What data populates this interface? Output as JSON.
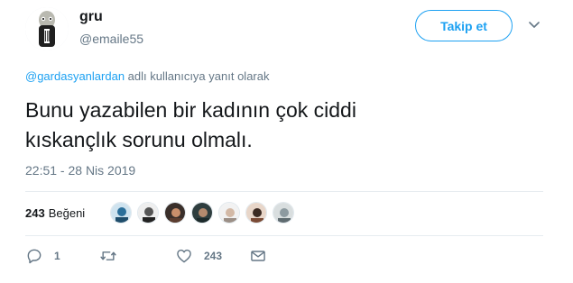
{
  "author": {
    "name": "gru",
    "handle": "@emaile55"
  },
  "follow_label": "Takip et",
  "reply_context": {
    "mention": "@gardasyanlardan",
    "suffix": "adlı kullanıcıya yanıt olarak"
  },
  "tweet": {
    "lines": [
      "Bunu yazabilen bir kadının çok ciddi",
      "kıskançlık sorunu olmalı."
    ],
    "timestamp": "22:51 - 28 Nis 2019"
  },
  "likes": {
    "count": "243",
    "label": "Beğeni"
  },
  "actions": {
    "reply_count": "1",
    "retweet_count": "",
    "like_count": "243"
  },
  "colors": {
    "accent": "#1da1f2",
    "muted": "#657786",
    "divider": "#e6ecf0"
  },
  "icons": [
    "gru-avatar",
    "chevron-down-icon",
    "reply-icon",
    "retweet-icon",
    "heart-icon",
    "dm-icon"
  ]
}
